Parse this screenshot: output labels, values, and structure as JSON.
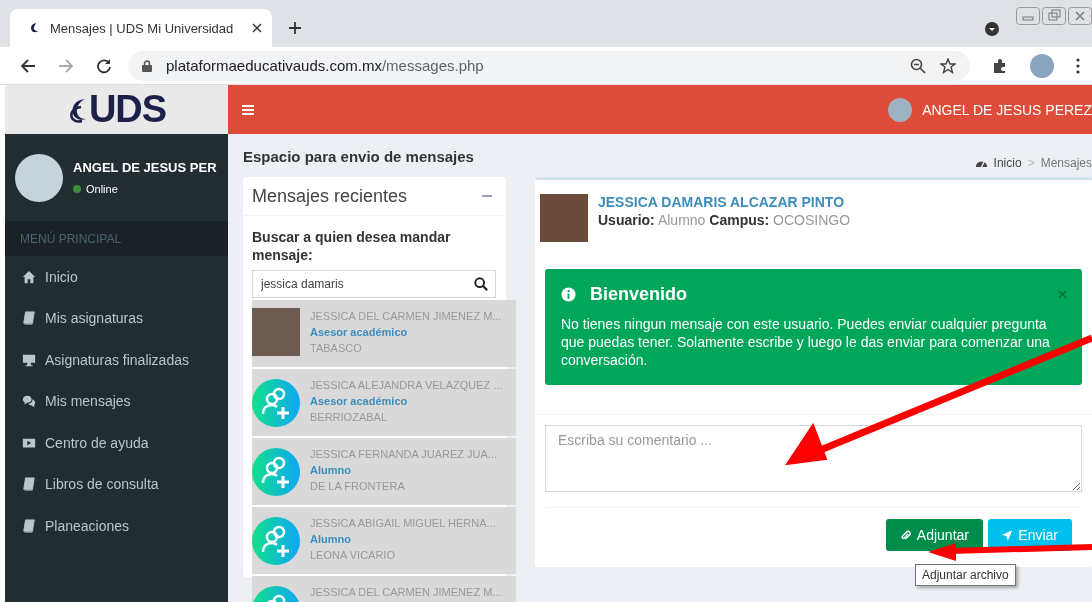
{
  "browser": {
    "tab_title": "Mensajes | UDS Mi Universidad",
    "url_host": "plataformaeducativauds.com.mx",
    "url_path": "/messages.php"
  },
  "header": {
    "logo": "UDS",
    "user_name": "ANGEL DE JESUS PEREZ"
  },
  "sidebar": {
    "user_name": "ANGEL DE JESUS PER",
    "status": "Online",
    "menu_header": "MENÚ PRINCIPAL",
    "items": [
      {
        "label": "Inicio",
        "kind": "home"
      },
      {
        "label": "Mis asignaturas",
        "kind": "book"
      },
      {
        "label": "Asignaturas finalizadas",
        "kind": "monitor"
      },
      {
        "label": "Mis mensajes",
        "kind": "chat"
      },
      {
        "label": "Centro de ayuda",
        "kind": "video"
      },
      {
        "label": "Libros de consulta",
        "kind": "book"
      },
      {
        "label": "Planeaciones",
        "kind": "book"
      }
    ]
  },
  "page": {
    "title": "Espacio para envio de mensajes",
    "breadcrumb": [
      "Inicio",
      "Mensajes"
    ],
    "breadcrumb_separator": ">"
  },
  "recent": {
    "title": "Mensajes recientes",
    "search_label": "Buscar a quien desea mandar mensaje:",
    "search_value": "jessica damaris",
    "results": [
      {
        "name": "JESSICA DEL CARMEN JIMENEZ M...",
        "role": "Asesor académico",
        "campus": "TABASCO",
        "kind": "photo"
      },
      {
        "name": "JESSICA ALEJANDRA VELAZQUEZ ...",
        "role": "Asesor académico",
        "campus": "BERRIOZABAL",
        "kind": "add-user"
      },
      {
        "name": "JESSICA FERNANDA JUAREZ JUA...",
        "role": "Alumno",
        "campus": "DE LA FRONTERA",
        "kind": "add-user"
      },
      {
        "name": "JESSICA ABIGAIL MIGUEL HERNA...",
        "role": "Alumno",
        "campus": "LEONA VICARIO",
        "kind": "add-user"
      },
      {
        "name": "JESSICA DEL CARMEN JIMENEZ M...",
        "kind": "add-user"
      }
    ]
  },
  "contact": {
    "name": "JESSICA DAMARIS ALCAZAR PINTO",
    "user_label": "Usuario:",
    "user_value": "Alumno",
    "campus_label": "Campus:",
    "campus_value": "OCOSINGO"
  },
  "alert": {
    "title": "Bienvenido",
    "text": "No tienes ningun mensaje con este usuario. Puedes enviar cualquier pregunta que puedas tener. Solamente escribe y luego le das enviar para comenzar una conversación."
  },
  "composer": {
    "placeholder": "Escriba su comentario ...",
    "buttons": [
      {
        "label": "Adjuntar",
        "kind": "attach"
      },
      {
        "label": "Enviar",
        "kind": "send"
      }
    ],
    "tooltip": "Adjuntar archivo"
  }
}
